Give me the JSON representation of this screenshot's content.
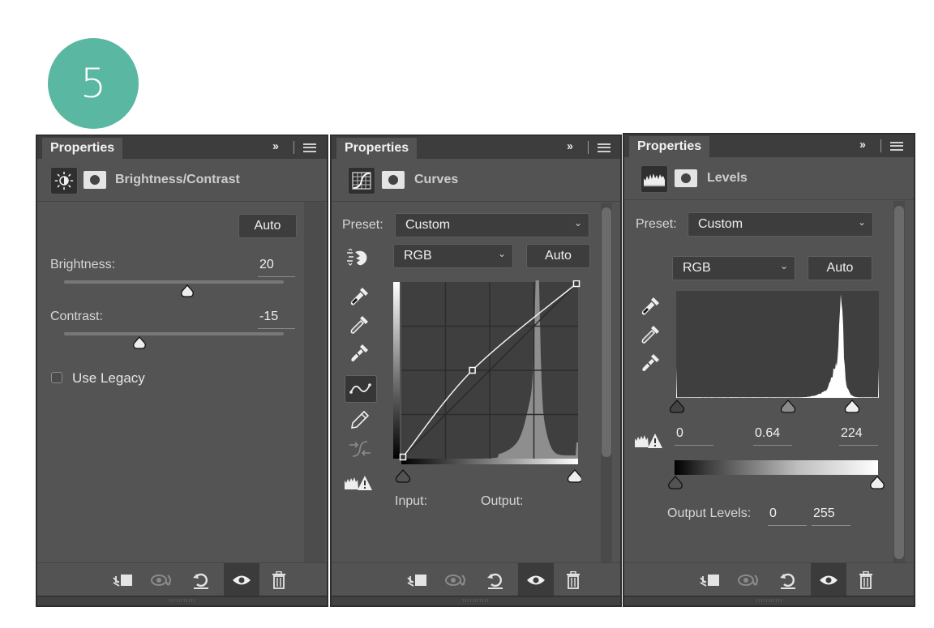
{
  "step_badge": {
    "number": "5",
    "color": "#5ab7a2"
  },
  "panels": [
    {
      "tab": "Properties",
      "collapse_label": "››",
      "adjustment": {
        "icon": "brightness-contrast-icon",
        "title": "Brightness/Contrast"
      },
      "auto_label": "Auto",
      "brightness": {
        "label": "Brightness:",
        "value": "20",
        "range": [
          -150,
          150
        ]
      },
      "contrast": {
        "label": "Contrast:",
        "value": "-15",
        "range": [
          -50,
          100
        ]
      },
      "use_legacy": {
        "label": "Use Legacy",
        "checked": false
      }
    },
    {
      "tab": "Properties",
      "collapse_label": "››",
      "adjustment": {
        "icon": "curves-icon",
        "title": "Curves"
      },
      "preset": {
        "label": "Preset:",
        "value": "Custom"
      },
      "channel": {
        "value": "RGB"
      },
      "auto_label": "Auto",
      "input_label": "Input:",
      "output_label": "Output:",
      "curve_points": [
        [
          0,
          0
        ],
        [
          0.4,
          0.5
        ],
        [
          1,
          1
        ]
      ]
    },
    {
      "tab": "Properties",
      "collapse_label": "››",
      "adjustment": {
        "icon": "levels-icon",
        "title": "Levels"
      },
      "preset": {
        "label": "Preset:",
        "value": "Custom"
      },
      "channel": {
        "value": "RGB"
      },
      "auto_label": "Auto",
      "input_levels": {
        "black": "0",
        "gamma": "0.64",
        "white": "224"
      },
      "output_levels": {
        "label": "Output Levels:",
        "black": "0",
        "white": "255"
      }
    }
  ],
  "footer_buttons": [
    "clip-to-layer",
    "view-previous-state",
    "reset-to-defaults",
    "toggle-visibility",
    "delete-adjustment"
  ]
}
